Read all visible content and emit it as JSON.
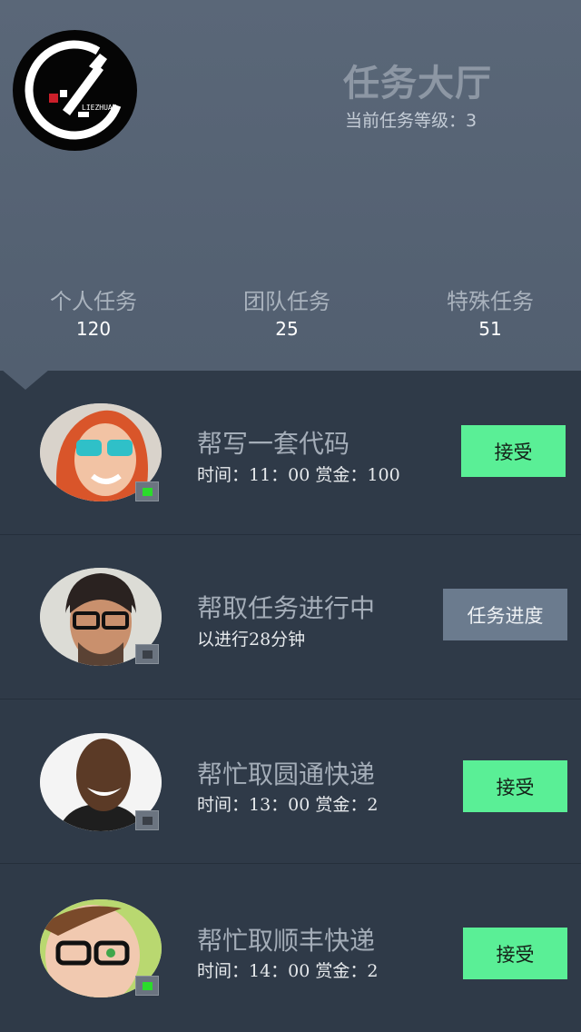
{
  "header": {
    "logo_text": "LIEZHUAN",
    "title": "任务大厅",
    "level_label": "当前任务等级：",
    "level_value": "3"
  },
  "stats": [
    {
      "label": "个人任务",
      "count": "120"
    },
    {
      "label": "团队任务",
      "count": "25"
    },
    {
      "label": "特殊任务",
      "count": "51"
    }
  ],
  "tasks": [
    {
      "title": "帮写一套代码",
      "meta": "时间：11：00 赏金：100",
      "action": "接受",
      "status": "online"
    },
    {
      "title": "帮取任务进行中",
      "meta": "以进行28分钟",
      "action": "任务进度",
      "status": "offline"
    },
    {
      "title": "帮忙取圆通快递",
      "meta": "时间：13：00 赏金：2",
      "action": "接受",
      "status": "offline"
    },
    {
      "title": "帮忙取顺丰快递",
      "meta": "时间：14：00 赏金：2",
      "action": "接受",
      "status": "online"
    }
  ],
  "colors": {
    "header_bg": "#525f70",
    "list_bg": "#2f3a48",
    "accept_button": "#5aef96",
    "progress_button": "#6b7b8e",
    "status_online": "#2bdc2b"
  }
}
